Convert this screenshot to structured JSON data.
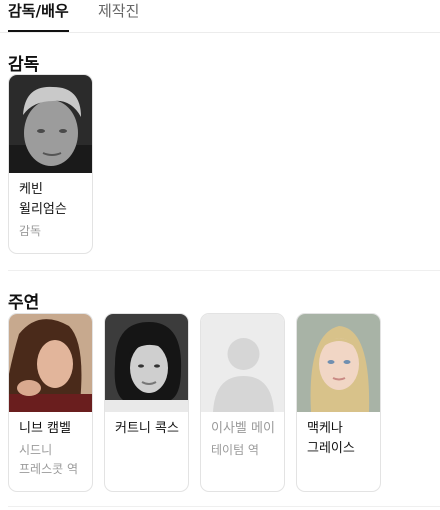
{
  "tabs": [
    {
      "label": "감독/배우",
      "active": true
    },
    {
      "label": "제작진",
      "active": false
    }
  ],
  "director": {
    "title": "감독",
    "people": [
      {
        "name": "케빈 윌리엄슨",
        "role": "감독",
        "photo": "photo-icon"
      }
    ]
  },
  "lead": {
    "title": "주연",
    "people": [
      {
        "name": "니브 캠벨",
        "role": "시드니 프레스콧 역",
        "photo": "photo-icon"
      },
      {
        "name": "커트니 콕스",
        "role": "",
        "photo": "photo-icon"
      },
      {
        "name": "이사벨 메이",
        "role": "테이텀 역",
        "photo": "person-placeholder-icon"
      },
      {
        "name": "맥케나 그레이스",
        "role": "",
        "photo": "photo-icon"
      }
    ]
  }
}
